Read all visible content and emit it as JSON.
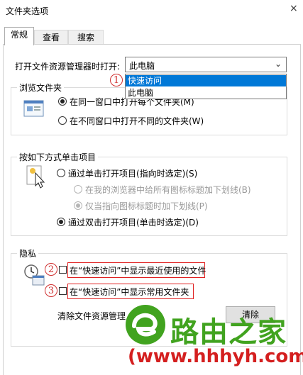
{
  "window": {
    "title": "文件夹选项",
    "close_glyph": "×"
  },
  "tabs": [
    {
      "label": "常规",
      "active": true
    },
    {
      "label": "查看",
      "active": false
    },
    {
      "label": "搜索",
      "active": false
    }
  ],
  "open_explorer": {
    "label": "打开文件资源管理器时打开:",
    "selected": "此电脑",
    "options": [
      {
        "label": "快速访问",
        "highlighted": true
      },
      {
        "label": "此电脑",
        "highlighted": false
      }
    ]
  },
  "browse_folders": {
    "title": "浏览文件夹",
    "same_window": "在同一窗口中打开每个文件夹(M)",
    "new_window": "在不同窗口中打开不同的文件夹(W)"
  },
  "click_items": {
    "title": "按如下方式单击项目",
    "single_click": "通过单击打开项目(指向时选定)(S)",
    "underline_browser": "在我的浏览器中给所有图标标题加下划线(B)",
    "underline_point": "仅当指向图标标题时加下划线(P)",
    "double_click": "通过双击打开项目(单击时选定)(D)"
  },
  "privacy": {
    "title": "隐私",
    "recent_files": "在“快速访问”中显示最近使用的文件",
    "frequent_folders": "在“快速访问”中显示常用文件夹",
    "clear_label": "清除文件资源管理",
    "clear_button": "清除"
  },
  "annotations": {
    "one": "1",
    "two": "2",
    "three": "3"
  },
  "watermark": {
    "brand": "路由之家",
    "url": "(www.hhhyh.com)"
  },
  "colors": {
    "accent": "#0078d7",
    "annotation_red": "#e02020",
    "watermark_green": "#41a31f"
  }
}
